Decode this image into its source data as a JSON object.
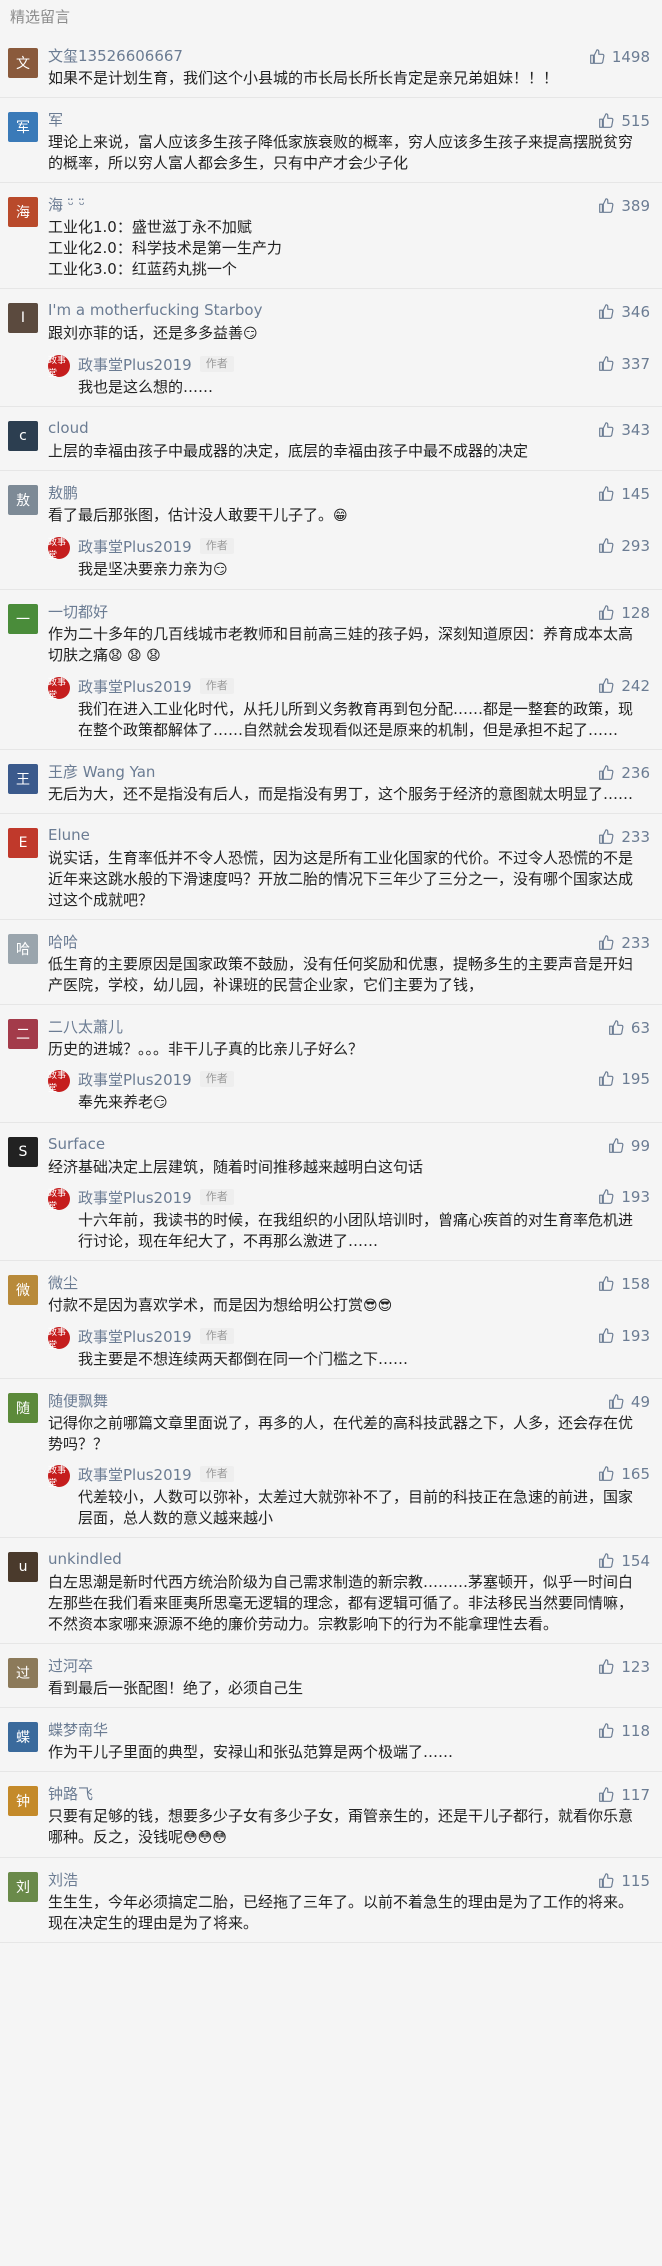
{
  "header": {
    "title": "精选留言"
  },
  "comments": [
    {
      "name": "文玺13526606667",
      "likes": "1498",
      "text": "如果不是计划生育，我们这个小县城的市长局长所长肯定是亲兄弟姐妹！！！",
      "avatar_color": "#8a5a3c",
      "avatar_char": "文"
    },
    {
      "name": "军",
      "likes": "515",
      "text": "理论上来说，富人应该多生孩子降低家族衰败的概率，穷人应该多生孩子来提高摆脱贫穷的概率，所以穷人富人都会多生，只有中产才会少子化",
      "avatar_color": "#3a7ab8",
      "avatar_char": "军"
    },
    {
      "name": "海 ᵕ̈ ᵕ̈",
      "likes": "389",
      "text": "工业化1.0：盛世滋丁永不加赋\n工业化2.0：科学技术是第一生产力\n工业化3.0：红蓝药丸挑一个",
      "avatar_color": "#b94a2b",
      "avatar_char": "海"
    },
    {
      "name": "I'm a motherfucking Starboy",
      "likes": "346",
      "text": "跟刘亦菲的话，还是多多益善",
      "emoji": "😏",
      "avatar_color": "#5b4a3e",
      "avatar_char": "I",
      "reply": {
        "name": "政事堂Plus2019",
        "badge": "作者",
        "likes": "337",
        "text": "我也是这么想的……"
      }
    },
    {
      "name": "cloud",
      "likes": "343",
      "text": "上层的幸福由孩子中最成器的决定，底层的幸福由孩子中最不成器的决定",
      "avatar_color": "#2c3e50",
      "avatar_char": "c"
    },
    {
      "name": "敖鹏",
      "likes": "145",
      "text": "看了最后那张图，估计没人敢要干儿子了。",
      "emoji": "😁",
      "avatar_color": "#7d8a96",
      "avatar_char": "敖",
      "reply": {
        "name": "政事堂Plus2019",
        "badge": "作者",
        "likes": "293",
        "text": "我是坚决要亲力亲为",
        "emoji": "😏"
      }
    },
    {
      "name": "一切都好",
      "likes": "128",
      "text": "作为二十多年的几百线城市老教师和目前高三娃的孩子妈，深刻知道原因：养育成本太高切肤之痛",
      "emoji": "😧 😧 😧",
      "avatar_color": "#4a8c3a",
      "avatar_char": "一",
      "reply": {
        "name": "政事堂Plus2019",
        "badge": "作者",
        "likes": "242",
        "text": "我们在进入工业化时代，从托儿所到义务教育再到包分配……都是一整套的政策，现在整个政策都解体了……自然就会发现看似还是原来的机制，但是承担不起了……"
      }
    },
    {
      "name": "王彦 Wang Yan",
      "likes": "236",
      "text": "无后为大，还不是指没有后人，而是指没有男丁，这个服务于经济的意图就太明显了……",
      "avatar_color": "#3b5a8c",
      "avatar_char": "王"
    },
    {
      "name": "Elune",
      "likes": "233",
      "text": "说实话，生育率低并不令人恐慌，因为这是所有工业化国家的代价。不过令人恐慌的不是近年来这跳水般的下滑速度吗？开放二胎的情况下三年少了三分之一，没有哪个国家达成过这个成就吧？",
      "avatar_color": "#c0392b",
      "avatar_char": "E"
    },
    {
      "name": "哈哈",
      "likes": "233",
      "text": "低生育的主要原因是国家政策不鼓励，没有任何奖励和优惠，提畅多生的主要声音是开妇产医院，学校，幼儿园，补课班的民营企业家，它们主要为了钱，",
      "avatar_color": "#9aa5ad",
      "avatar_char": "哈"
    },
    {
      "name": "二八太蕭儿",
      "likes": "63",
      "text": "历史的进城？。。。非干儿子真的比亲儿子好么？",
      "avatar_color": "#a33b4a",
      "avatar_char": "二",
      "reply": {
        "name": "政事堂Plus2019",
        "badge": "作者",
        "likes": "195",
        "text": "奉先来养老",
        "emoji": "😏"
      }
    },
    {
      "name": "Surface",
      "likes": "99",
      "text": "经济基础决定上层建筑，随着时间推移越来越明白这句话",
      "avatar_color": "#222222",
      "avatar_char": "S",
      "reply": {
        "name": "政事堂Plus2019",
        "badge": "作者",
        "likes": "193",
        "text": "十六年前，我读书的时候，在我组织的小团队培训时，曾痛心疾首的对生育率危机进行讨论，现在年纪大了，不再那么激进了……"
      }
    },
    {
      "name": "微尘",
      "likes": "158",
      "text": "付款不是因为喜欢学术，而是因为想给明公打赏",
      "emoji": "😎😎",
      "avatar_color": "#b88a3a",
      "avatar_char": "微",
      "reply": {
        "name": "政事堂Plus2019",
        "badge": "作者",
        "likes": "193",
        "text": "我主要是不想连续两天都倒在同一个门槛之下……"
      }
    },
    {
      "name": "随便飘舞",
      "likes": "49",
      "text": "记得你之前哪篇文章里面说了，再多的人，在代差的高科技武器之下，人多，还会存在优势吗？？",
      "avatar_color": "#5c8a3a",
      "avatar_char": "随",
      "reply": {
        "name": "政事堂Plus2019",
        "badge": "作者",
        "likes": "165",
        "text": "代差较小，人数可以弥补，太差过大就弥补不了，目前的科技正在急速的前进，国家层面，总人数的意义越来越小"
      }
    },
    {
      "name": "unkindled",
      "likes": "154",
      "text": "白左思潮是新时代西方统治阶级为自己需求制造的新宗教………茅塞顿开，似乎一时间白左那些在我们看来匪夷所思毫无逻辑的理念，都有逻辑可循了。非法移民当然要同情嘛，不然资本家哪来源源不绝的廉价劳动力。宗教影响下的行为不能拿理性去看。",
      "avatar_color": "#4a3a2c",
      "avatar_char": "u"
    },
    {
      "name": "过河卒",
      "likes": "123",
      "text": "看到最后一张配图！绝了，必须自己生",
      "avatar_color": "#8c7a5a",
      "avatar_char": "过"
    },
    {
      "name": "蝶梦南华",
      "likes": "118",
      "text": "作为干儿子里面的典型，安禄山和张弘范算是两个极端了……",
      "avatar_color": "#3a6a9c",
      "avatar_char": "蝶"
    },
    {
      "name": "钟路飞",
      "likes": "117",
      "text": "只要有足够的钱，想要多少子女有多少子女，甭管亲生的，还是干儿子都行，就看你乐意哪种。反之，没钱呢",
      "emoji": "😳😳😳",
      "avatar_color": "#c48a2a",
      "avatar_char": "钟"
    },
    {
      "name": "刘浩",
      "likes": "115",
      "text": "生生生，今年必须搞定二胎，已经拖了三年了。以前不着急生的理由是为了工作的将来。现在决定生的理由是为了将来。",
      "avatar_color": "#6a8a4a",
      "avatar_char": "刘"
    }
  ],
  "colors": {
    "background": "#f5f5f5",
    "name": "#6b7c93",
    "text": "#222222",
    "header": "#8c8c8c"
  },
  "icons": {
    "like": "thumbs-up-icon"
  }
}
